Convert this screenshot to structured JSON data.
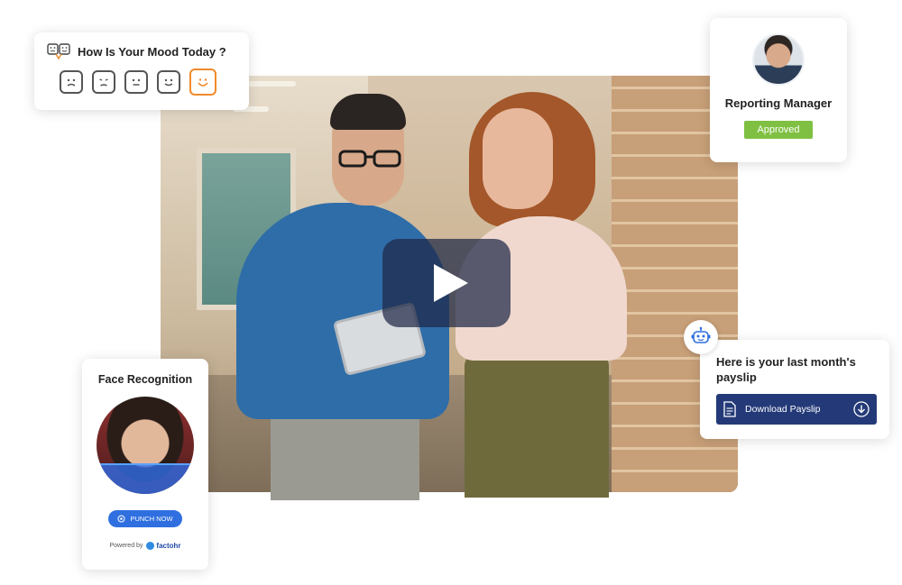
{
  "mood": {
    "title": "How Is Your Mood Today ?",
    "faces": [
      "very-sad",
      "sad",
      "neutral",
      "happy",
      "very-happy"
    ],
    "selected": "very-happy",
    "accent": "#f08a2c"
  },
  "manager": {
    "title": "Reporting Manager",
    "status": "Approved",
    "status_color": "#7fc042"
  },
  "payslip": {
    "message": "Here is your last month's payslip",
    "button_label": "Download Payslip",
    "button_color": "#243a78"
  },
  "face_recognition": {
    "title": "Face Recognition",
    "punch_label": "PUNCH NOW",
    "powered_by": "Powered by",
    "brand": "factohr"
  },
  "video": {
    "play_icon": "play-icon"
  }
}
